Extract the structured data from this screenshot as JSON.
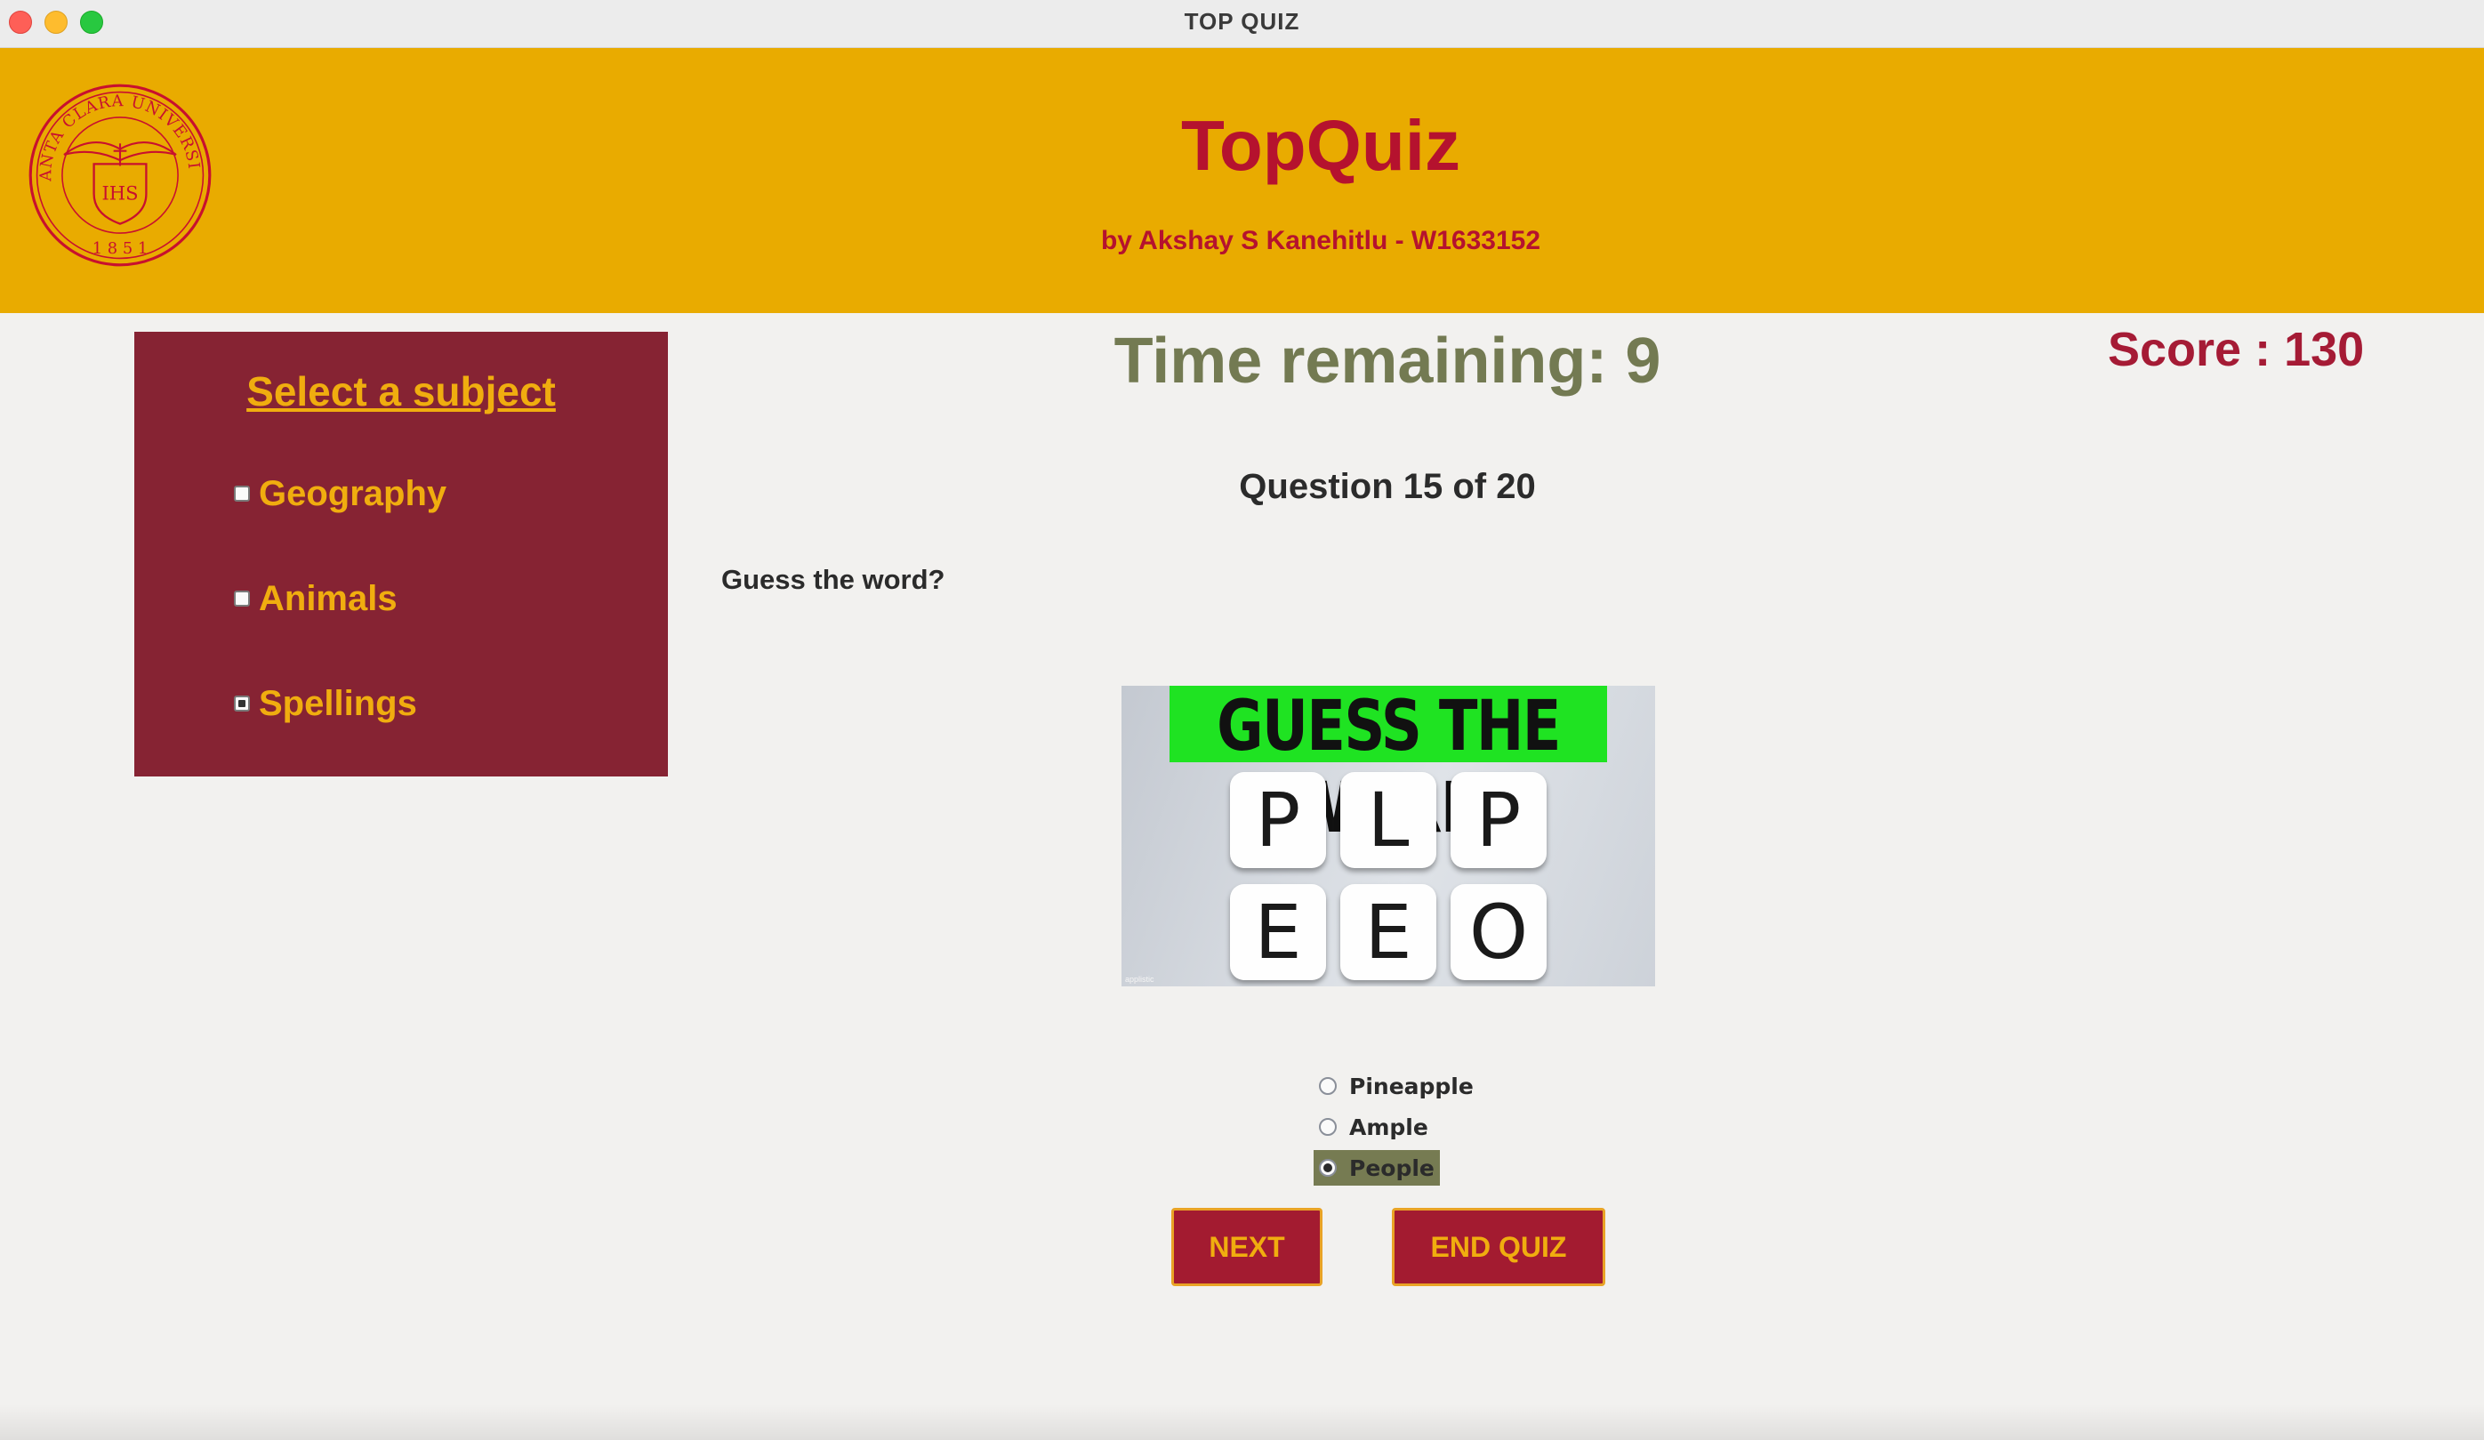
{
  "window": {
    "title": "TOP QUIZ"
  },
  "header": {
    "title": "TopQuiz",
    "byline": "by Akshay S Kanehitlu - W1633152",
    "seal": {
      "top_text": "SANTA CLARA UNIVERSITY",
      "monogram": "IHS",
      "year": "1 8 5 1"
    }
  },
  "sidebar": {
    "title": "Select a subject",
    "subjects": [
      {
        "label": "Geography",
        "checked": false
      },
      {
        "label": "Animals",
        "checked": false
      },
      {
        "label": "Spellings",
        "checked": true
      }
    ]
  },
  "quiz": {
    "time_remaining": "Time remaining: 9",
    "score": "Score : 130",
    "question_number": "Question 15 of 20",
    "question_text": "Guess the word?",
    "image": {
      "banner": "GUESS THE WORD",
      "letters": [
        "P",
        "L",
        "P",
        "E",
        "E",
        "O"
      ],
      "credit": "applistic"
    },
    "options": [
      {
        "label": "Pineapple",
        "selected": false
      },
      {
        "label": "Ample",
        "selected": false
      },
      {
        "label": "People",
        "selected": true
      }
    ],
    "next_label": "NEXT",
    "end_label": "END QUIZ"
  },
  "colors": {
    "header_bg": "#e9ab00",
    "brand_red": "#b5122e",
    "sidebar_bg": "#862333",
    "gold_text": "#f0ad0f",
    "timer_text": "#737a52",
    "button_bg": "#a31b30"
  }
}
